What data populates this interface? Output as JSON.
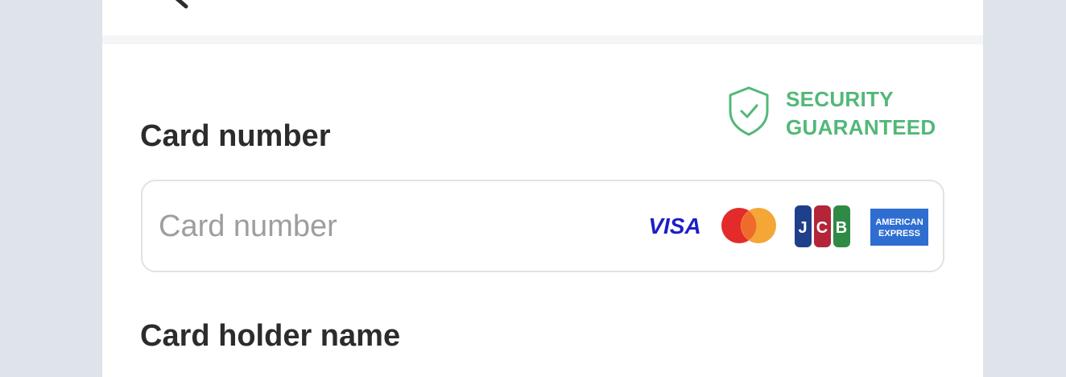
{
  "header": {
    "back_icon": "back-arrow-icon"
  },
  "security": {
    "line1": "SECURITY",
    "line2": "GUARANTEED",
    "icon": "shield-check-icon",
    "color": "#52b878"
  },
  "card_number": {
    "label": "Card number",
    "placeholder": "Card number",
    "value": ""
  },
  "card_brands": [
    {
      "name": "visa-logo",
      "text": "VISA"
    },
    {
      "name": "mastercard-logo",
      "text": ""
    },
    {
      "name": "jcb-logo",
      "text": "JCB"
    },
    {
      "name": "amex-logo",
      "text": "AMERICAN EXPRESS"
    }
  ],
  "card_holder": {
    "label": "Card holder name"
  }
}
